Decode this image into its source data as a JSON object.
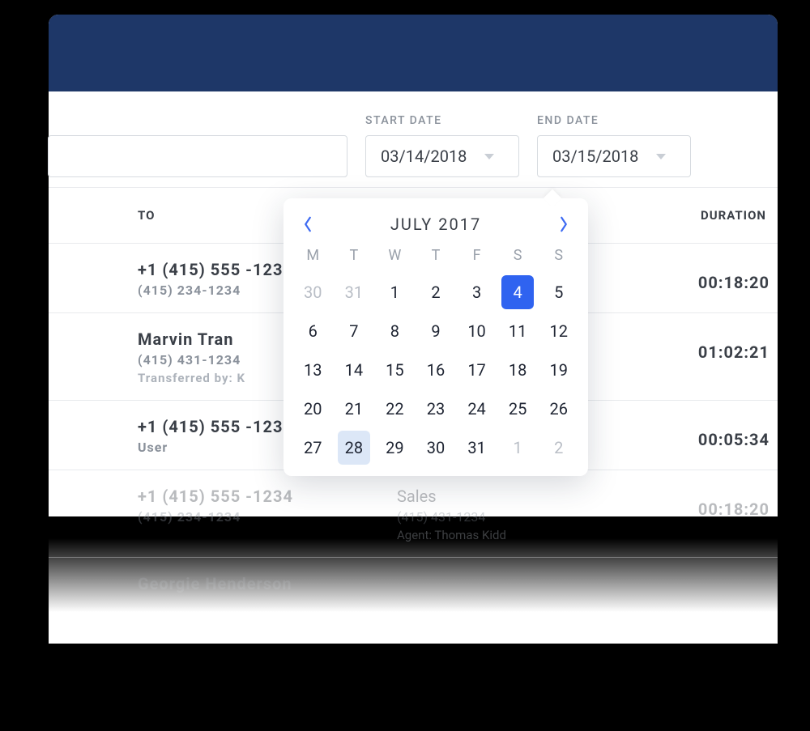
{
  "filters": {
    "start_label": "START DATE",
    "start_value": "03/14/2018",
    "end_label": "END DATE",
    "end_value": "03/15/2018"
  },
  "columns": {
    "to": "TO",
    "duration": "DURATION"
  },
  "rows": [
    {
      "icon": "phone-outgoing",
      "icon_color": "green",
      "primary": "+1 (415) 555 -1234",
      "secondary": "(415) 234-1234",
      "tertiary": "",
      "mid_primary": "",
      "mid_secondary": "",
      "mid_tertiary": "",
      "duration": "00:18:20"
    },
    {
      "icon": "phone-incoming",
      "icon_color": "amber",
      "primary": "Marvin Tran",
      "secondary": "(415) 431-1234",
      "tertiary": "Transferred by: K",
      "mid_primary": "",
      "mid_secondary": "",
      "mid_tertiary": "",
      "duration": "01:02:21"
    },
    {
      "icon": "phone-incoming",
      "icon_color": "amber",
      "primary": "+1 (415) 555 -1234",
      "secondary": "User",
      "tertiary": "",
      "mid_primary": "",
      "mid_secondary": "",
      "mid_tertiary": "",
      "duration": "00:05:34"
    },
    {
      "icon": "phone-outgoing",
      "icon_color": "green",
      "primary": "+1 (415) 555 -1234",
      "secondary": "(415) 234-1234",
      "tertiary": "",
      "mid_primary": "Sales",
      "mid_secondary": "(415) 431-1234",
      "mid_tertiary": "Agent: Thomas Kidd",
      "duration": "00:18:20"
    },
    {
      "icon": "",
      "icon_color": "",
      "primary": "Georgie Henderson",
      "secondary": "",
      "tertiary": "",
      "mid_primary": "",
      "mid_secondary": "",
      "mid_tertiary": "",
      "duration": ""
    }
  ],
  "calendar": {
    "title": "JULY 2017",
    "weekdays": [
      "M",
      "T",
      "W",
      "T",
      "F",
      "S",
      "S"
    ],
    "cells": [
      {
        "d": "30",
        "cls": "other"
      },
      {
        "d": "31",
        "cls": "other"
      },
      {
        "d": "1"
      },
      {
        "d": "2"
      },
      {
        "d": "3"
      },
      {
        "d": "4",
        "cls": "selected"
      },
      {
        "d": "5"
      },
      {
        "d": "6"
      },
      {
        "d": "7"
      },
      {
        "d": "8"
      },
      {
        "d": "9"
      },
      {
        "d": "10"
      },
      {
        "d": "11"
      },
      {
        "d": "12"
      },
      {
        "d": "13"
      },
      {
        "d": "14"
      },
      {
        "d": "15"
      },
      {
        "d": "16"
      },
      {
        "d": "17"
      },
      {
        "d": "18"
      },
      {
        "d": "19"
      },
      {
        "d": "20"
      },
      {
        "d": "21"
      },
      {
        "d": "22"
      },
      {
        "d": "23"
      },
      {
        "d": "24"
      },
      {
        "d": "25"
      },
      {
        "d": "26"
      },
      {
        "d": "27"
      },
      {
        "d": "28",
        "cls": "highlighted"
      },
      {
        "d": "29"
      },
      {
        "d": "30"
      },
      {
        "d": "31"
      },
      {
        "d": "1",
        "cls": "other"
      },
      {
        "d": "2",
        "cls": "other"
      }
    ]
  }
}
